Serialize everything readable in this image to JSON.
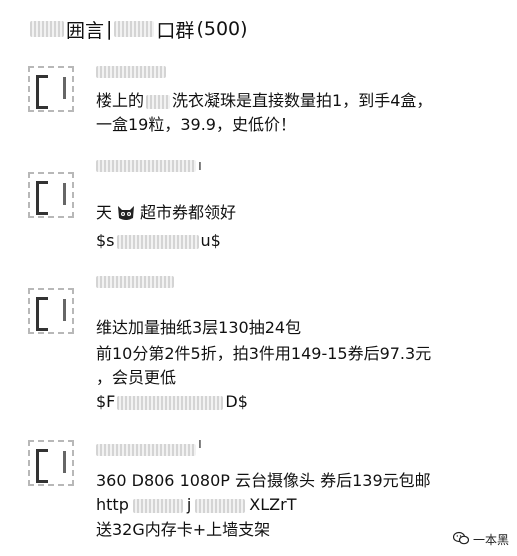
{
  "header": {
    "title_a": "囲言",
    "title_sep": "|",
    "title_b": "口群",
    "count": "(500)"
  },
  "messages": [
    {
      "lines": [
        "楼上的",
        "洗衣凝珠是直接数量拍1，到手4盒，",
        "一盒19粒，39.9，史低价！"
      ]
    },
    {
      "sender_mark": "ı",
      "lines": [
        "天",
        "超市券都领好",
        "$s",
        "u$"
      ]
    },
    {
      "lines": [
        "维达加量抽纸3层130抽24包",
        "前10分第2件5折，拍3件用149-15券后97.3元",
        "，会员更低",
        "$F",
        "D$"
      ]
    },
    {
      "sender_mark": "ı",
      "lines": [
        "360 D806 1080P 云台摄像头 券后139元包邮",
        "http",
        "j",
        "XLZrT",
        "送32G内存卡+上墙支架"
      ]
    }
  ],
  "watermark": {
    "text": "一本黑"
  },
  "icons": {
    "cat": "cat-face-icon",
    "wechat": "wechat-icon"
  }
}
